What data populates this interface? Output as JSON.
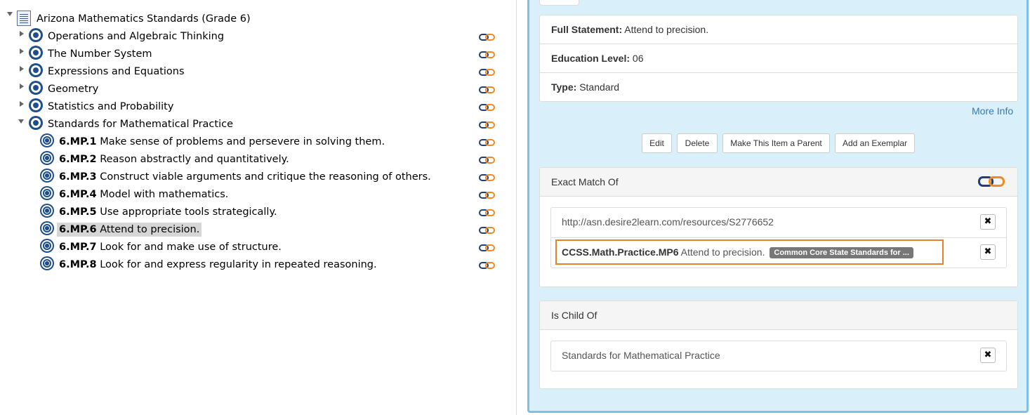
{
  "tree": {
    "root": "Arizona Mathematics Standards (Grade 6)",
    "domains": [
      "Operations and Algebraic Thinking",
      "The Number System",
      "Expressions and Equations",
      "Geometry",
      "Statistics and Probability",
      "Standards for Mathematical Practice"
    ],
    "standards": [
      {
        "code": "6.MP.1",
        "text": "Make sense of problems and persevere in solving them."
      },
      {
        "code": "6.MP.2",
        "text": "Reason abstractly and quantitatively."
      },
      {
        "code": "6.MP.3",
        "text": "Construct viable arguments and critique the reasoning of others."
      },
      {
        "code": "6.MP.4",
        "text": "Model with mathematics."
      },
      {
        "code": "6.MP.5",
        "text": "Use appropriate tools strategically."
      },
      {
        "code": "6.MP.6",
        "text": "Attend to precision."
      },
      {
        "code": "6.MP.7",
        "text": "Look for and make use of structure."
      },
      {
        "code": "6.MP.8",
        "text": "Look for and express regularity in repeated reasoning."
      }
    ],
    "selected": "6.MP.6"
  },
  "details": {
    "full_statement_label": "Full Statement:",
    "full_statement": "Attend to precision.",
    "education_level_label": "Education Level:",
    "education_level": "06",
    "type_label": "Type:",
    "type": "Standard",
    "more_info": "More Info"
  },
  "buttons": {
    "edit": "Edit",
    "delete": "Delete",
    "make_parent": "Make This Item a Parent",
    "add_exemplar": "Add an Exemplar"
  },
  "exact_match": {
    "heading": "Exact Match Of",
    "url": "http://asn.desire2learn.com/resources/S2776652",
    "code": "CCSS.Math.Practice.MP6",
    "text": "Attend to precision.",
    "badge": "Common Core State Standards for ..."
  },
  "child_of": {
    "heading": "Is Child Of",
    "item": "Standards for Mathematical Practice"
  },
  "icons": {
    "remove": "✖",
    "link": "link-icon",
    "node": "bullseye-icon",
    "doc": "document-icon"
  },
  "colors": {
    "accent_orange": "#e8822a",
    "link_blue": "#337ab7",
    "panel_bg": "#d9effa",
    "panel_border": "#7cc0e4",
    "node_blue": "#1f4e8c"
  }
}
